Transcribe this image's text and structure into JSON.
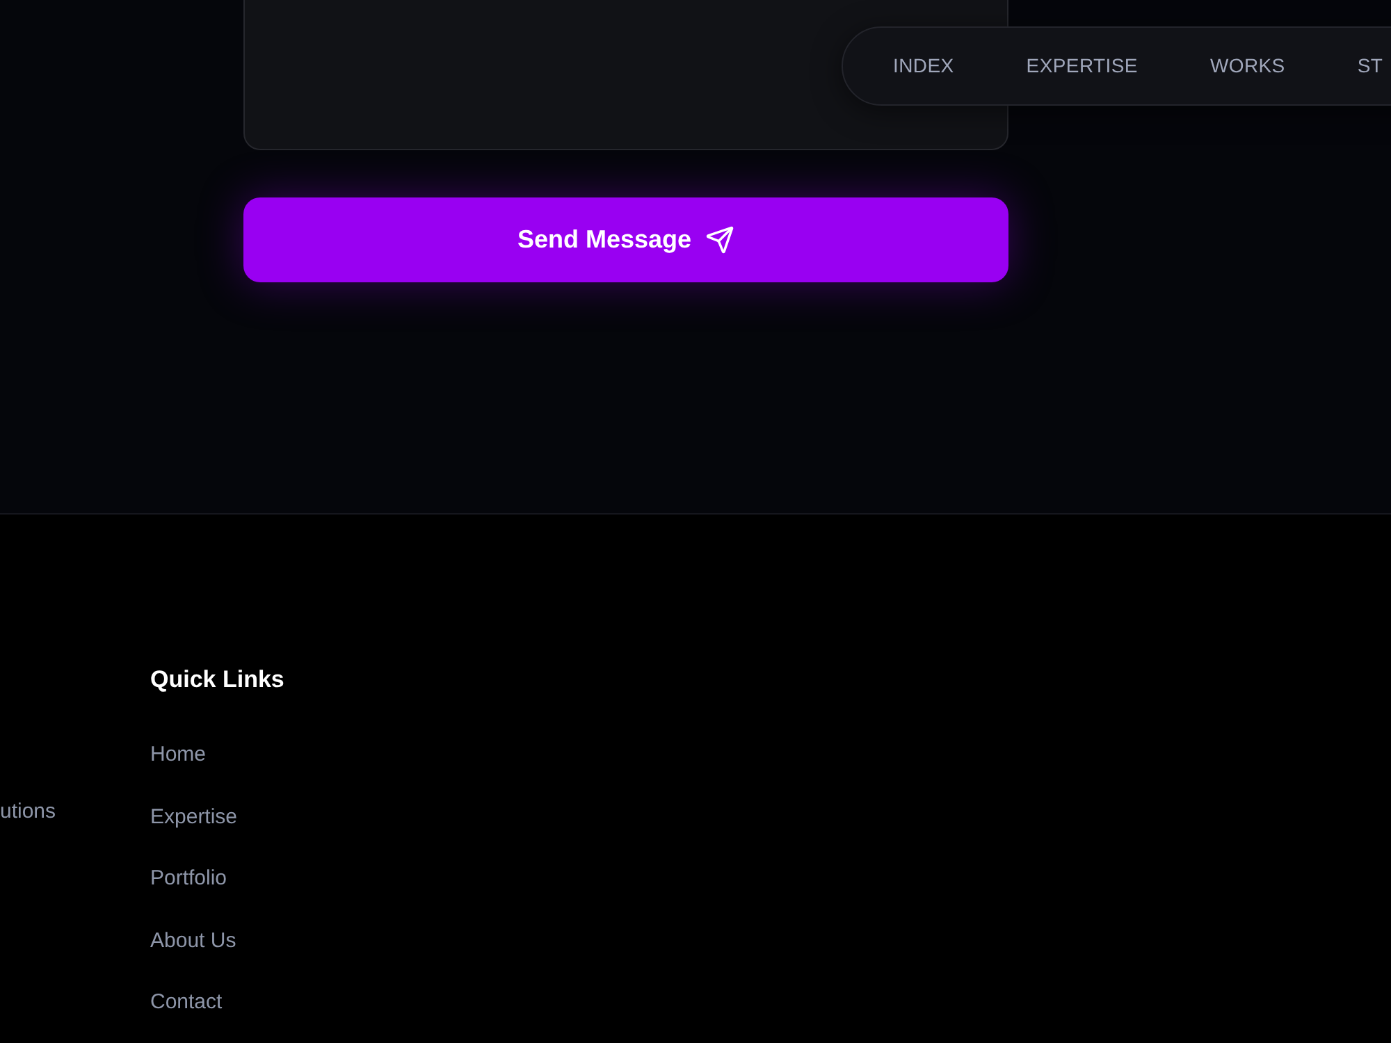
{
  "contact_form": {
    "submit_button": {
      "label": "Send Message"
    }
  },
  "nav": {
    "items": [
      {
        "label": "INDEX"
      },
      {
        "label": "EXPERTISE"
      },
      {
        "label": "WORKS"
      },
      {
        "label": "ST"
      }
    ]
  },
  "footer": {
    "column_1": {
      "items": [
        "utions"
      ]
    },
    "quick_links": {
      "title": "Quick Links",
      "links": [
        "Home",
        "Expertise",
        "Portfolio",
        "About Us",
        "Contact"
      ]
    }
  }
}
